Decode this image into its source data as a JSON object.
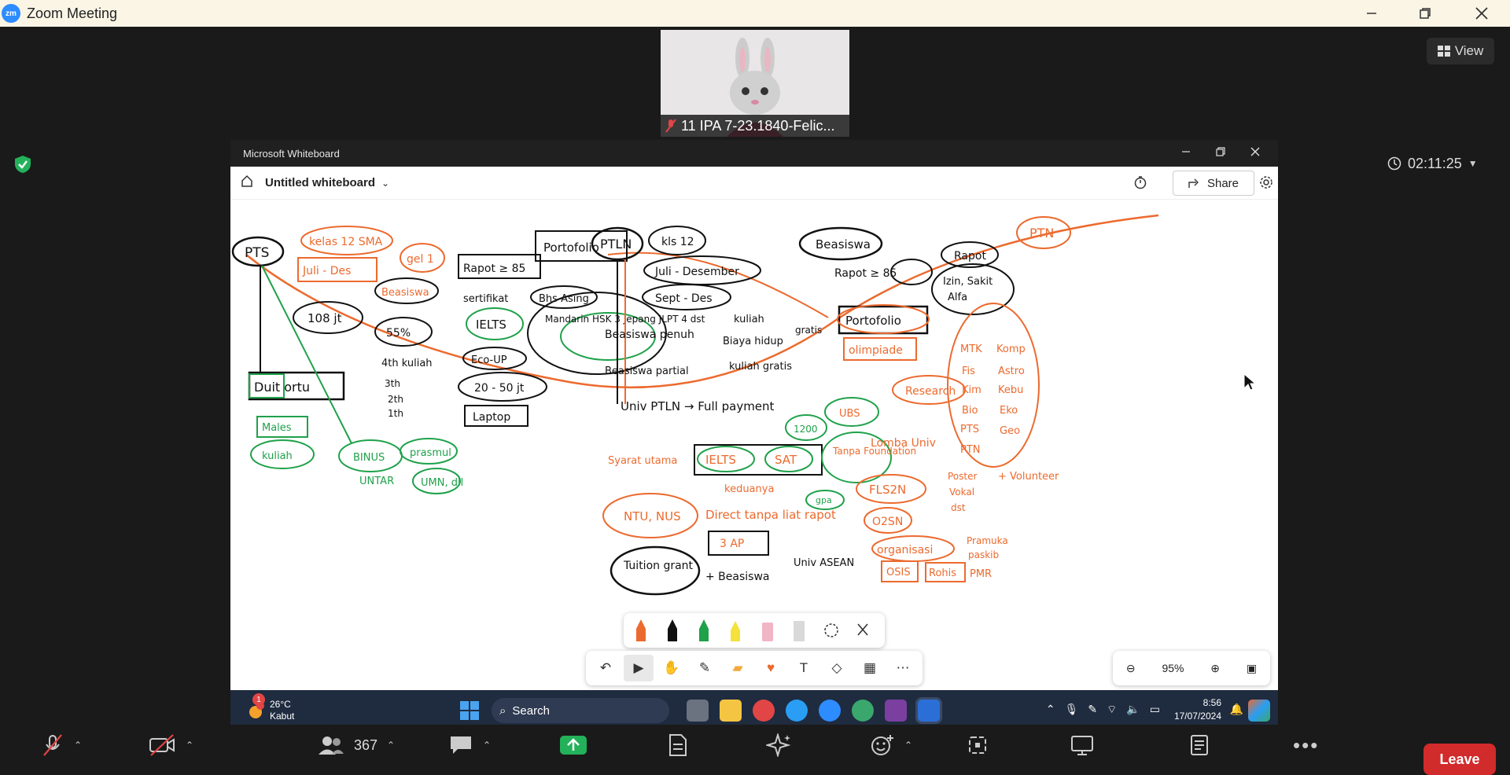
{
  "app": {
    "title": "Zoom Meeting"
  },
  "view_button": {
    "label": "View"
  },
  "video_tile": {
    "participant_name": "11 IPA 7-23.1840-Felic..."
  },
  "timer": {
    "elapsed": "02:11:25"
  },
  "whiteboard": {
    "app_title": "Microsoft Whiteboard",
    "board_title": "Untitled whiteboard",
    "share_label": "Share",
    "zoom_level": "95%"
  },
  "canvas_text": {
    "pts": "PTS",
    "kelas12sma": "kelas 12 SMA",
    "juli_des": "Juli - Des",
    "gel1": "gel 1",
    "beasiswa_o": "Beasiswa",
    "rapot85": "Rapot ≥ 85",
    "portofolio1": "Portofolio",
    "sertifikat": "sertifikat",
    "bhs_asing": "Bhs Asing",
    "persentase": "108 jt",
    "ielts1": "IELTS",
    "mandarin": "Mandarin HSK 3 Jepang JLPT 4 dst",
    "persen": "55%",
    "kuliah4": "4th kuliah",
    "ecoup": "Eco-UP",
    "duit_ortu": "Duit ortu",
    "range": "20 - 50 jt",
    "laptop": "Laptop",
    "t3": "3th",
    "t2": "2th",
    "t1": "1th",
    "males": "Males",
    "kuliah": "kuliah",
    "binus": "BINUS",
    "prasmul": "prasmul",
    "untar": "UNTAR",
    "umn": "UMN, dll",
    "ptln": "PTLN",
    "kls12": "kls 12",
    "juli_des2": "Juli - Desember",
    "sept_des": "Sept - Des",
    "beasiswa_penuh": "Beasiswa penuh",
    "kuliah2": "kuliah",
    "biaya_hidup": "Biaya hidup",
    "gratis": "gratis",
    "beasiswa_partial": "Beasiswa partial",
    "kuliah_gratis": "kuliah gratis",
    "univ_ptln": "Univ PTLN → Full payment",
    "syarat": "Syarat utama",
    "ielts2": "IELTS",
    "sat": "SAT",
    "kedua": "keduanya",
    "n1200": "1200",
    "ubs": "UBS",
    "tanpa_foundation": "Tanpa Foundation",
    "gpa": "gpa",
    "ntu_nus": "NTU, NUS",
    "direct": "Direct tanpa liat rapot",
    "n3ap": "3 AP",
    "tuition_grant": "Tuition grant",
    "plus_beasiswa": "+ Beasiswa",
    "univ_asean": "Univ ASEAN",
    "beasiswa2": "Beasiswa",
    "rapot85b": "Rapot ≥ 85",
    "rapot": "Rapot",
    "izin": "Izin, Sakit",
    "alfa": "Alfa",
    "ptn": "PTN",
    "portofolio2": "Portofolio",
    "olimpiade": "olimpiade",
    "research": "Research",
    "mtk": "MTK",
    "fis": "Fis",
    "kim": "Kim",
    "bio": "Bio",
    "komp": "Komp",
    "astro": "Astro",
    "kebu": "Kebu",
    "eko": "Eko",
    "geo": "Geo",
    "lomba_univ": "Lomba Univ",
    "pts2": "PTS",
    "ptn2": "PTN",
    "fls2n": "FLS2N",
    "poster": "Poster",
    "vokal": "Vokal",
    "dst": "dst",
    "volunteer": "+ Volunteer",
    "o2sn": "O2SN",
    "organisasi": "organisasi",
    "pramuka": "Pramuka",
    "paskib": "paskib",
    "osis": "OSIS",
    "rohis": "Rohis",
    "pmr": "PMR"
  },
  "taskbar": {
    "temperature": "26°C",
    "weather": "Kabut",
    "search_placeholder": "Search",
    "time": "8:56",
    "date": "17/07/2024",
    "notification_count": "1"
  },
  "controls": {
    "participants_count": "367",
    "leave_label": "Leave"
  },
  "colors": {
    "orange": "#ec6a2e",
    "green": "#1fa14a",
    "ink": "#111111",
    "leave": "#d12b2b"
  }
}
